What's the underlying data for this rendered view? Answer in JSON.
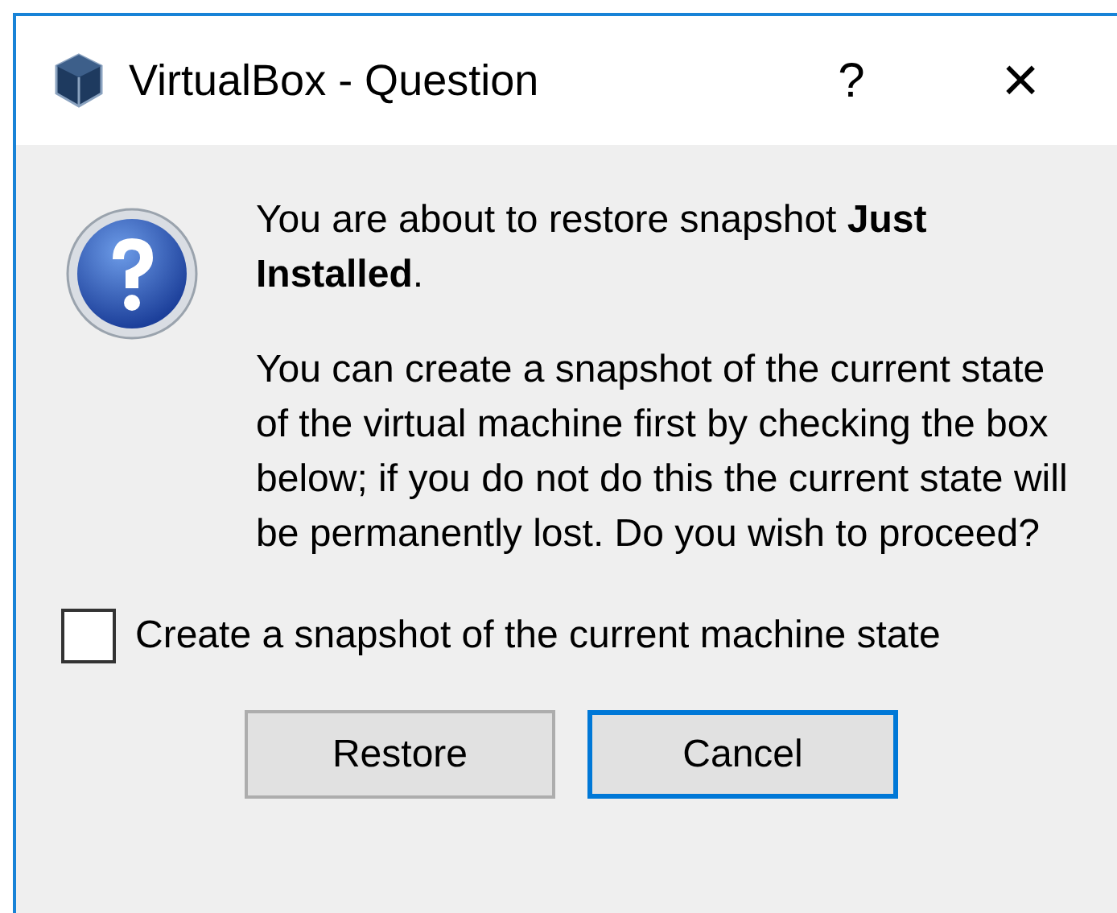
{
  "window": {
    "title": "VirtualBox - Question",
    "help": "?",
    "close": "×"
  },
  "messages": [
    "You are about to restore snapshot **Just Installed**.",
    "You can create a snapshot of the current state of the virtual machine first by checking the box below; if you do not do this the current state will be permanently lost. Do you wish to proceed?"
  ],
  "checkbox": {
    "label": "Create a snapshot of the current machine state",
    "checked": false
  },
  "buttons": [
    {
      "label": "Restore",
      "focused": false
    },
    {
      "label": "Cancel",
      "focused": true
    }
  ]
}
